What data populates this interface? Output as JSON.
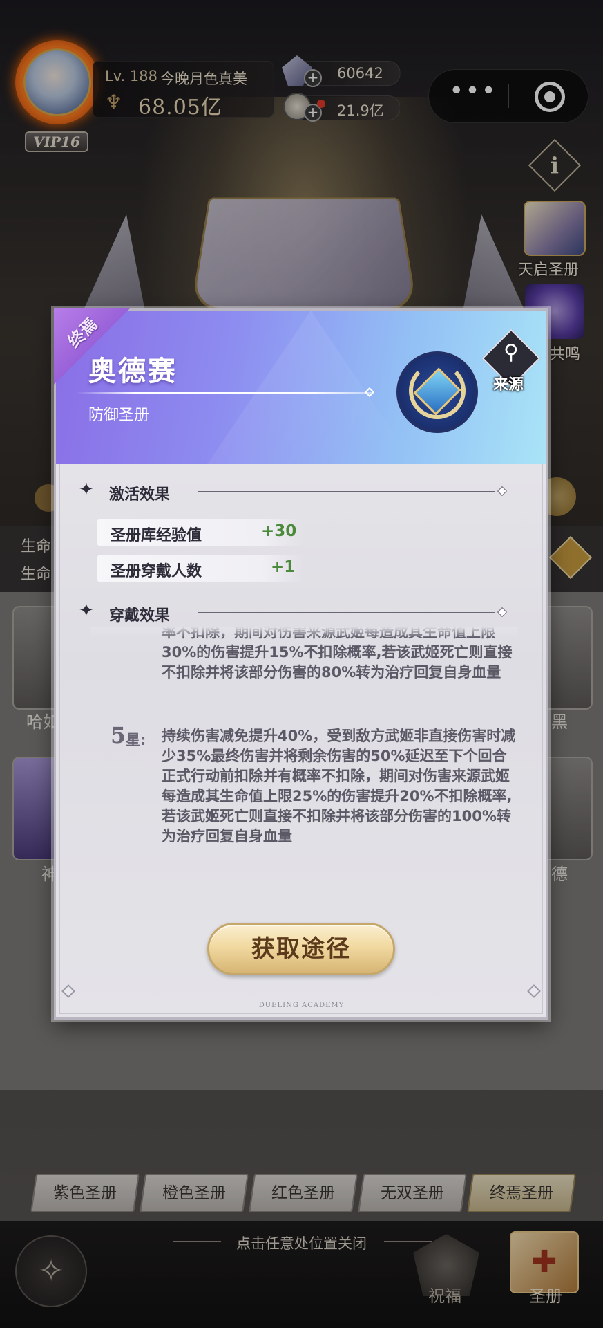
{
  "player": {
    "level_prefix": "Lv.",
    "level": "188",
    "name": "今晚月色真美",
    "power": "68.05亿",
    "vip": "VIP16"
  },
  "resources": {
    "gems": "60642",
    "coins": "21.9亿"
  },
  "side_menu": {
    "item1_label": "天启圣册",
    "item2_label": "共鸣"
  },
  "background_list": {
    "stat_label_1": "生命",
    "stat_label_2": "生命",
    "card_left_1": "哈如",
    "card_left_2": "神",
    "card_right_1": "黑",
    "card_right_2": "德"
  },
  "modal": {
    "rarity": "终焉",
    "title": "奥德赛",
    "subtitle": "防御圣册",
    "source_label": "来源",
    "activation": {
      "heading": "激活效果",
      "stats": [
        {
          "label": "圣册库经验值",
          "value": "+30"
        },
        {
          "label": "圣册穿戴人数",
          "value": "+1"
        }
      ]
    },
    "wear": {
      "heading": "穿戴效果",
      "partial_text": "率不扣除，期间对伤害来源武姬每造成其生命值上限30%的伤害提升15%不扣除概率,若该武姬死亡则直接不扣除并将该部分伤害的80%转为治疗回复自身血量",
      "star_level": "5",
      "star_unit": "星:",
      "star_text": "持续伤害减免提升40%，受到敌方武姬非直接伤害时减少35%最终伤害并将剩余伤害的50%延迟至下个回合正式行动前扣除并有概率不扣除，期间对伤害来源武姬每造成其生命值上限25%的伤害提升20%不扣除概率,若该武姬死亡则直接不扣除并将该部分伤害的100%转为治疗回复自身血量"
    },
    "acquire_button": "获取途径",
    "footer_brand": "DUELING ACADEMY"
  },
  "tabs": [
    {
      "label": "紫色圣册",
      "active": false
    },
    {
      "label": "橙色圣册",
      "active": false
    },
    {
      "label": "红色圣册",
      "active": false
    },
    {
      "label": "无双圣册",
      "active": false
    },
    {
      "label": "终焉圣册",
      "active": true
    }
  ],
  "bottom": {
    "close_hint": "点击任意处位置关闭",
    "bless_label": "祝福",
    "book_label": "圣册"
  },
  "colors": {
    "accent_gold": "#d6b574",
    "header_purple": "#8a6ee6",
    "header_cyan": "#a9e4f7",
    "stat_green": "#4a8a3a"
  }
}
